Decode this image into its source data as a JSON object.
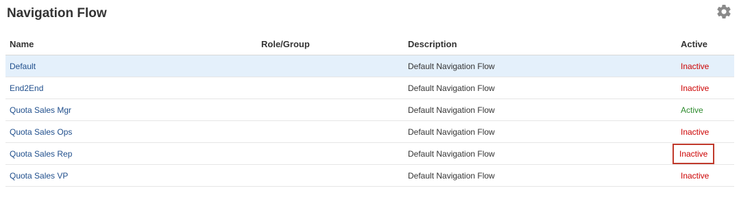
{
  "panel": {
    "title": "Navigation Flow",
    "settings_icon": "gear-icon"
  },
  "table": {
    "columns": {
      "name": "Name",
      "role": "Role/Group",
      "description": "Description",
      "active": "Active"
    },
    "rows": [
      {
        "name": "Default",
        "role": "",
        "description": "Default Navigation Flow",
        "active": "Inactive",
        "status": "inactive",
        "selected": true,
        "highlighted": false
      },
      {
        "name": "End2End",
        "role": "",
        "description": "Default Navigation Flow",
        "active": "Inactive",
        "status": "inactive",
        "selected": false,
        "highlighted": false
      },
      {
        "name": "Quota Sales Mgr",
        "role": "",
        "description": "Default Navigation Flow",
        "active": "Active",
        "status": "active",
        "selected": false,
        "highlighted": false
      },
      {
        "name": "Quota Sales Ops",
        "role": "",
        "description": "Default Navigation Flow",
        "active": "Inactive",
        "status": "inactive",
        "selected": false,
        "highlighted": false
      },
      {
        "name": "Quota Sales Rep",
        "role": "",
        "description": "Default Navigation Flow",
        "active": "Inactive",
        "status": "inactive",
        "selected": false,
        "highlighted": true
      },
      {
        "name": "Quota Sales VP",
        "role": "",
        "description": "Default Navigation Flow",
        "active": "Inactive",
        "status": "inactive",
        "selected": false,
        "highlighted": false
      }
    ]
  },
  "colors": {
    "link": "#1f4e8c",
    "inactive": "#cc0000",
    "active": "#2d8a2d",
    "selected_row": "#e4f0fb",
    "highlight_box": "#c0392b"
  }
}
